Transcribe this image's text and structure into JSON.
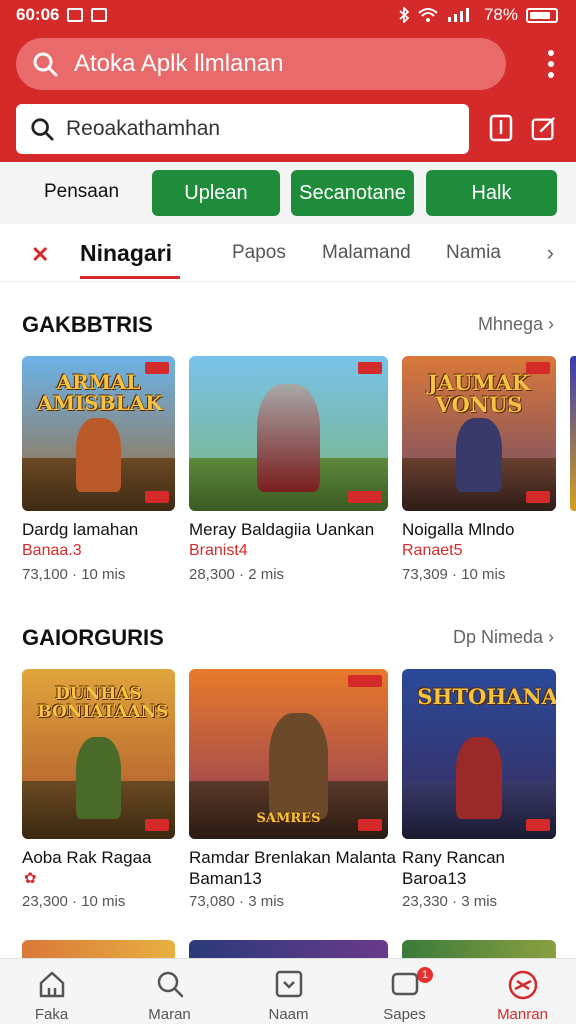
{
  "status_bar": {
    "time": "60:06",
    "battery": "78%"
  },
  "header": {
    "search_title": "Atoka Aplk llmlanan",
    "search_query": "Reoakathamhan"
  },
  "filters": {
    "plain": "Pensaan",
    "chips": [
      "Uplean",
      "Secanotane",
      "Halk"
    ]
  },
  "tabs": {
    "active": "Ninagari",
    "items": [
      "Papos",
      "Malamand",
      "Namia"
    ]
  },
  "sections": [
    {
      "title": "GAKBBTRIS",
      "more": "Mhnega",
      "items": [
        {
          "art_title": "ARMAL AMISBLAK",
          "name": "Dardg lamahan",
          "sub": "Banaa.3",
          "meta": "73,100 · 10 mis"
        },
        {
          "art_title": "",
          "name": "Meray Baldagiia Uankan",
          "sub": "Branist4",
          "meta": "28,300 · 2 mis"
        },
        {
          "art_title": "JAUMAK VONUS",
          "name": "Noigalla Mlndo",
          "sub": "Ranaet5",
          "meta": "73,309 · 10 mis"
        }
      ]
    },
    {
      "title": "GAIORGURIS",
      "more": "Dp Nimeda",
      "items": [
        {
          "art_title": "DUNHAS BONIATAANS",
          "name": "Aoba Rak Ragaa",
          "sub": "",
          "meta": "23,300 · 10 mis"
        },
        {
          "art_title": "SAMRES",
          "name": "Ramdar Brenlakan Malanta",
          "sub": "Baman13",
          "meta": "73,080 · 3 mis"
        },
        {
          "art_title": "SHTOHANA",
          "name": "Rany Rancan",
          "sub": "Baroa13",
          "meta": "23,330 · 3 mis"
        }
      ]
    }
  ],
  "bottom_nav": [
    {
      "label": "Faka",
      "icon": "home-icon"
    },
    {
      "label": "Maran",
      "icon": "search-icon"
    },
    {
      "label": "Naam",
      "icon": "inbox-icon"
    },
    {
      "label": "Sapes",
      "icon": "chat-icon",
      "badge": "1"
    },
    {
      "label": "Manran",
      "icon": "compass-icon"
    }
  ],
  "colors": {
    "brand": "#d42a2a",
    "chip": "#1f8c3b"
  }
}
